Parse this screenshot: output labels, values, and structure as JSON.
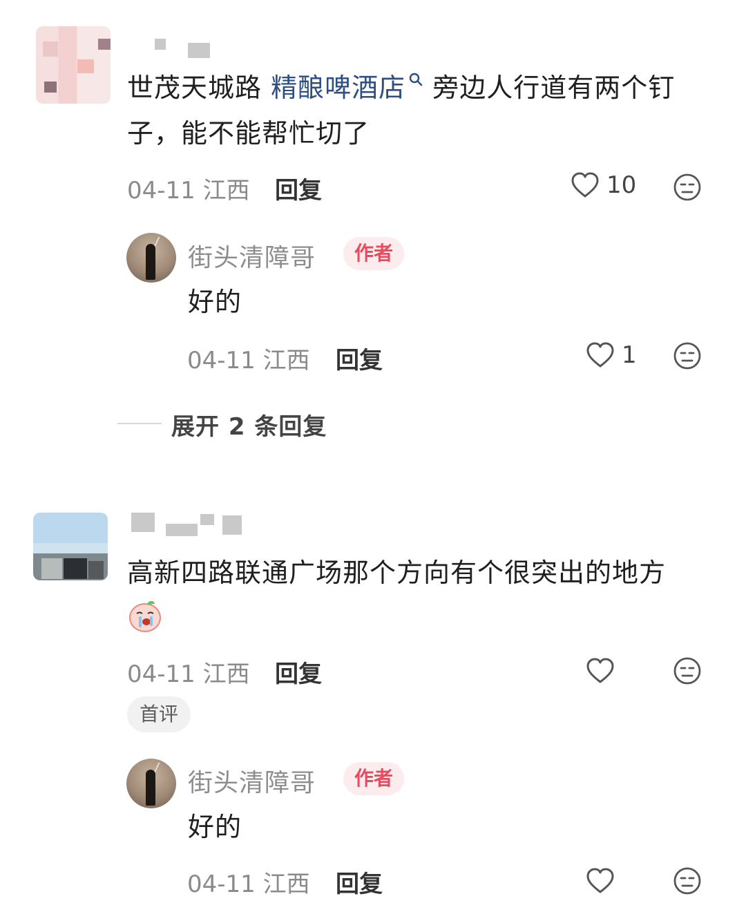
{
  "comments": [
    {
      "text_prefix": "世茂天城路 ",
      "link_text": "精酿啤酒店",
      "text_suffix_line1": " 旁边人行道有两个钉",
      "text_line2": "子，能不能帮忙切了",
      "meta": "04-11 江西",
      "reply_label": "回复",
      "like_count": "10",
      "author_reply": {
        "name": "街头清障哥",
        "tag": "作者",
        "text": "好的",
        "meta": "04-11 江西",
        "reply_label": "回复",
        "like_count": "1"
      },
      "expand_label": "展开 2 条回复"
    },
    {
      "text_line1": "高新四路联通广场那个方向有个很突出的地方",
      "meta": "04-11 江西",
      "reply_label": "回复",
      "badge": "首评",
      "author_reply": {
        "name": "街头清障哥",
        "tag": "作者",
        "text": "好的",
        "meta": "04-11 江西",
        "reply_label": "回复"
      }
    }
  ],
  "icons": {
    "heart": "heart-icon",
    "emoji": "sleepy-face-icon",
    "search": "search-icon",
    "sticker": "crying-peach-sticker"
  },
  "colors": {
    "link": "#2c4f84",
    "author_tag": "#e84b5e",
    "author_tag_bg": "#fdecee"
  }
}
